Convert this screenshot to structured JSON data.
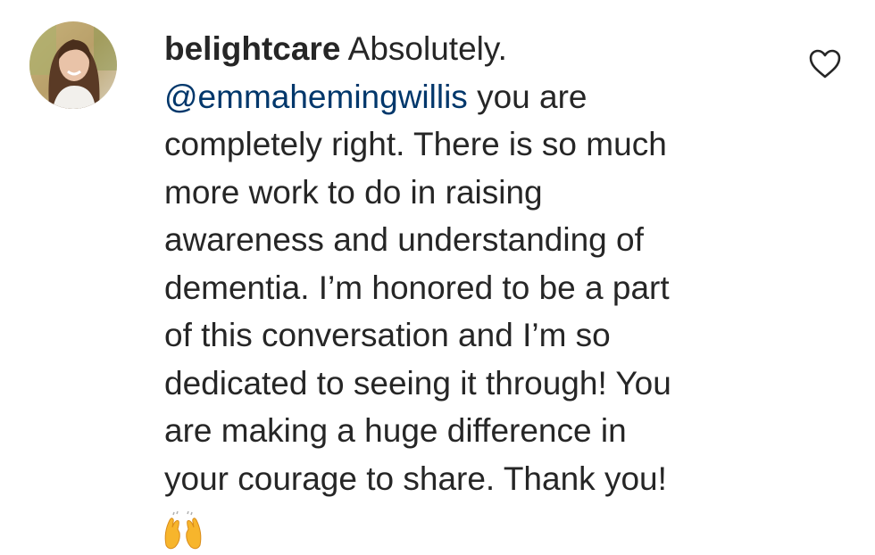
{
  "comment": {
    "username": "belightcare",
    "lines": [
      "Absolutely.",
      "@emmahemingwillis",
      "you are",
      "completely right. There is so much",
      "more work to do in raising",
      "awareness and understanding of",
      "dementia. I’m honored to be a part",
      "of this conversation and I’m so",
      "dedicated to seeing it through! You",
      "are making a huge difference in",
      "your courage to share. Thank you!"
    ],
    "emoji": "raising-hands-emoji",
    "like_icon": "heart-outline-icon",
    "avatar": "profile-photo-avatar"
  }
}
